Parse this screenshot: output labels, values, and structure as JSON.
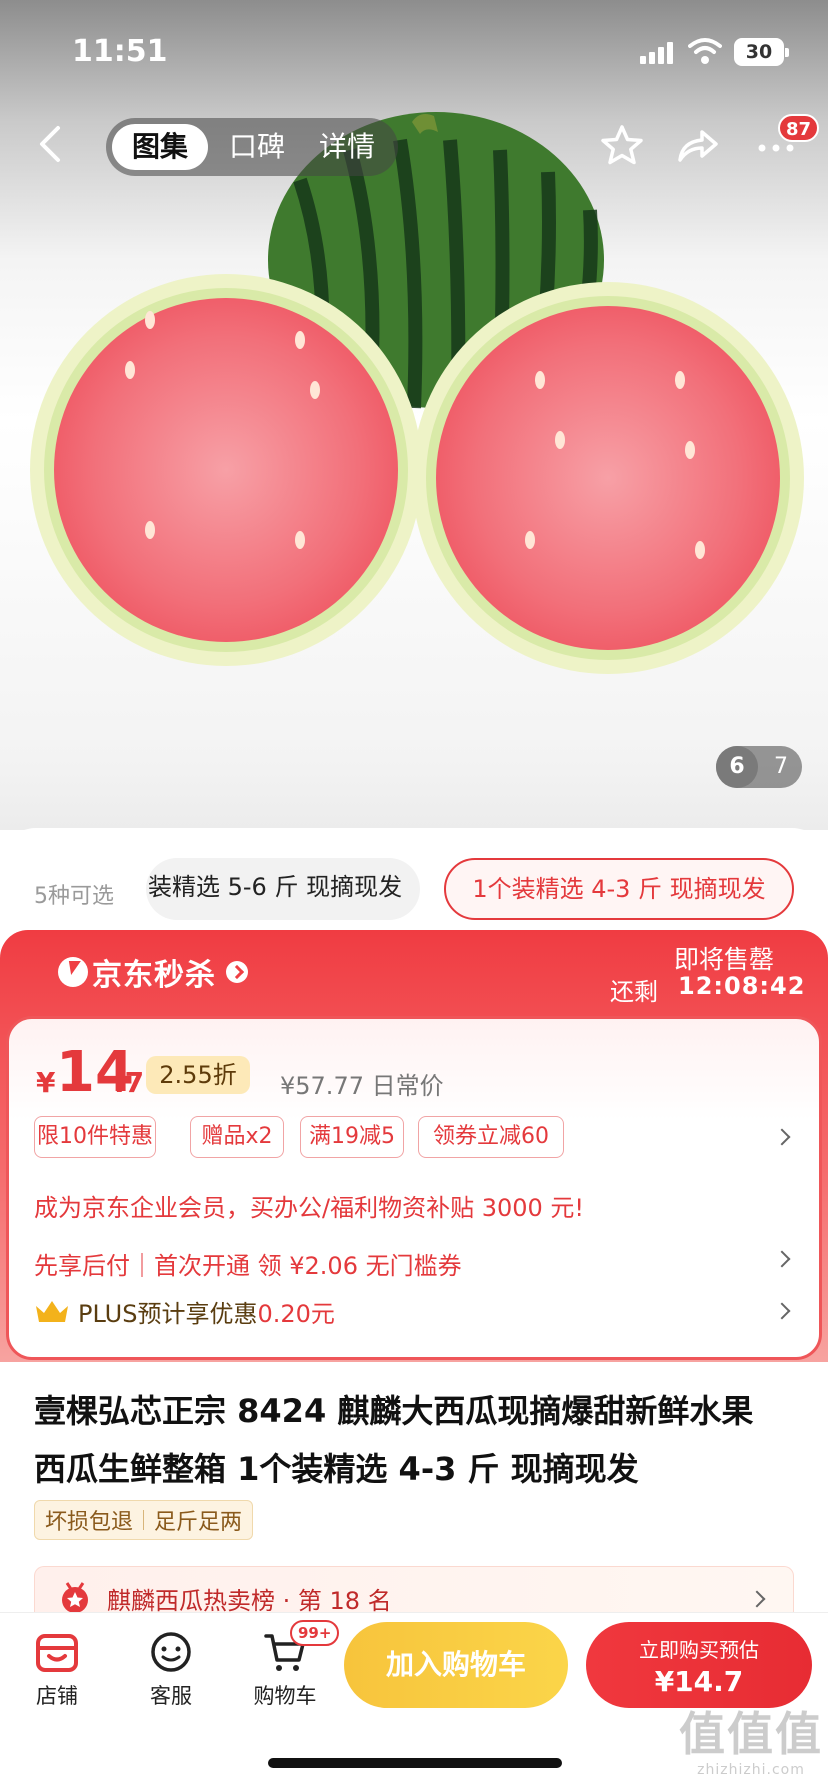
{
  "status_bar": {
    "time": "11:51",
    "battery": "30"
  },
  "header": {
    "tabs": [
      {
        "label": "图集"
      },
      {
        "label": "口碑"
      },
      {
        "label": "详情"
      }
    ],
    "more_badge": "87"
  },
  "gallery": {
    "current": "6",
    "total": "7"
  },
  "variants": {
    "count_label": "5种可选",
    "options": [
      {
        "label": "装精选 5-6 斤 现摘现发"
      },
      {
        "label": "1个装精选 4-3 斤 现摘现发"
      }
    ]
  },
  "flash_sale": {
    "brand": "京东秒杀",
    "status": "即将售罄",
    "remain_label": "还剩",
    "countdown": "12:08:42"
  },
  "price": {
    "yen": "¥",
    "integer": "14",
    "decimal": ".7",
    "discount": "2.55折",
    "original": "¥57.77 日常价"
  },
  "promo_tags": [
    {
      "label": "限10件特惠"
    },
    {
      "label": "赠品x2"
    },
    {
      "label": "满19减5"
    },
    {
      "label": "领券立减60"
    }
  ],
  "promos": {
    "enterprise": "成为京东企业会员，买办公/福利物资补贴 3000 元!",
    "pay_later": "先享后付｜首次开通 领 ¥2.06 无门槛券",
    "plus_text": "PLUS预计享优惠",
    "plus_value": "0.20元"
  },
  "product": {
    "title_line1": "壹棵弘芯正宗 8424 麒麟大西瓜现摘爆甜新鲜水果",
    "title_line2": "西瓜生鲜整箱 1个装精选 4-3 斤 现摘现发",
    "guarantees": [
      "坏损包退",
      "足斤足两"
    ],
    "ranking": "麒麟西瓜热卖榜 · 第 18 名"
  },
  "bottom_bar": {
    "shop": "店铺",
    "service": "客服",
    "cart": "购物车",
    "cart_badge": "99+",
    "add_to_cart": "加入购物车",
    "buy_now_line1": "立即购买预估",
    "buy_now_line2": "¥14.7"
  },
  "watermark": {
    "line1": "值值值",
    "line2": "zhizhizhi.com"
  },
  "colors": {
    "accent": "#e4393c",
    "cart_button": "#f9c944",
    "flash_gradient_top": "#f03c42"
  }
}
